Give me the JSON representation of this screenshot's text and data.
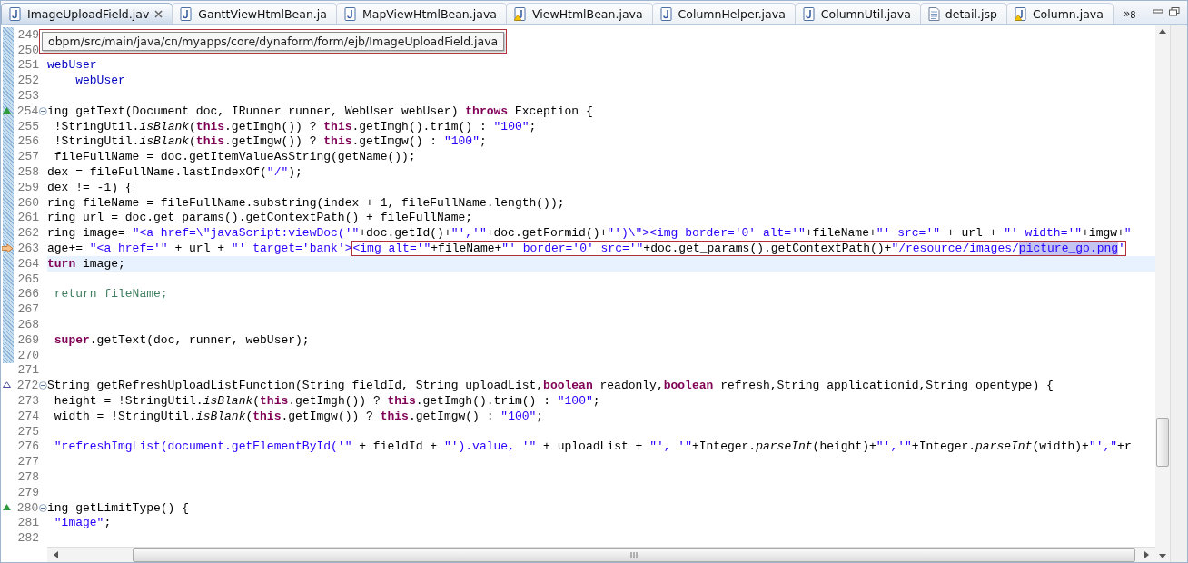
{
  "tabs": [
    {
      "label": "ImageUploadField.jav",
      "selected": true,
      "kind": "java"
    },
    {
      "label": "GanttViewHtmlBean.ja",
      "selected": false,
      "kind": "java"
    },
    {
      "label": "MapViewHtmlBean.java",
      "selected": false,
      "kind": "java"
    },
    {
      "label": "ViewHtmlBean.java",
      "selected": false,
      "kind": "warning"
    },
    {
      "label": "ColumnHelper.java",
      "selected": false,
      "kind": "java"
    },
    {
      "label": "ColumnUtil.java",
      "selected": false,
      "kind": "java"
    },
    {
      "label": "detail.jsp",
      "selected": false,
      "kind": "jsp"
    },
    {
      "label": "Column.java",
      "selected": false,
      "kind": "warning"
    }
  ],
  "overflow": {
    "glyph": "»",
    "count": "8"
  },
  "tooltip": "obpm/src/main/java/cn/myapps/core/dynaform/form/ejb/ImageUploadField.java",
  "lines": [
    {
      "no": "249",
      "changed": true,
      "current": false
    },
    {
      "no": "250",
      "changed": true,
      "current": false
    },
    {
      "no": "251",
      "changed": true,
      "current": false,
      "tokens": [
        {
          "kind": "field",
          "text": "webUser"
        }
      ]
    },
    {
      "no": "252",
      "changed": true,
      "current": false,
      "tokens": [
        {
          "kind": "field",
          "text": "    webUser"
        }
      ]
    },
    {
      "no": "253",
      "changed": true,
      "current": false
    },
    {
      "no": "254",
      "changed": true,
      "current": false,
      "kind": "override",
      "expanded": true,
      "tokens": [
        {
          "kind": "plain",
          "text": "ing getText(Document doc, IRunner runner, WebUser webUser) "
        },
        {
          "kind": "keyword",
          "text": "throws"
        },
        {
          "kind": "plain",
          "text": " Exception {"
        }
      ]
    },
    {
      "no": "255",
      "changed": true,
      "current": false,
      "tokens": [
        {
          "kind": "plain",
          "text": " !StringUtil."
        },
        {
          "kind": "italic",
          "text": "isBlank"
        },
        {
          "kind": "plain",
          "text": "("
        },
        {
          "kind": "keyword",
          "text": "this"
        },
        {
          "kind": "plain",
          "text": ".getImgh()) ? "
        },
        {
          "kind": "keyword",
          "text": "this"
        },
        {
          "kind": "plain",
          "text": ".getImgh().trim() : "
        },
        {
          "kind": "string",
          "text": "\"100\""
        },
        {
          "kind": "plain",
          "text": ";"
        }
      ]
    },
    {
      "no": "256",
      "changed": true,
      "current": false,
      "tokens": [
        {
          "kind": "plain",
          "text": " !StringUtil."
        },
        {
          "kind": "italic",
          "text": "isBlank"
        },
        {
          "kind": "plain",
          "text": "("
        },
        {
          "kind": "keyword",
          "text": "this"
        },
        {
          "kind": "plain",
          "text": ".getImgw()) ? "
        },
        {
          "kind": "keyword",
          "text": "this"
        },
        {
          "kind": "plain",
          "text": ".getImgw() : "
        },
        {
          "kind": "string",
          "text": "\"100\""
        },
        {
          "kind": "plain",
          "text": ";"
        }
      ]
    },
    {
      "no": "257",
      "changed": true,
      "current": false,
      "tokens": [
        {
          "kind": "plain",
          "text": " fileFullName = doc.getItemValueAsString(getName());"
        }
      ]
    },
    {
      "no": "258",
      "changed": true,
      "current": false,
      "tokens": [
        {
          "kind": "plain",
          "text": "dex = fileFullName.lastIndexOf("
        },
        {
          "kind": "string",
          "text": "\"/\""
        },
        {
          "kind": "plain",
          "text": ");"
        }
      ]
    },
    {
      "no": "259",
      "changed": true,
      "current": false,
      "tokens": [
        {
          "kind": "plain",
          "text": "dex != -1) {"
        }
      ]
    },
    {
      "no": "260",
      "changed": true,
      "current": false,
      "tokens": [
        {
          "kind": "plain",
          "text": "ring fileName = fileFullName.substring(index + 1, fileFullName.length());"
        }
      ]
    },
    {
      "no": "261",
      "changed": true,
      "current": false,
      "tokens": [
        {
          "kind": "plain",
          "text": "ring url = doc.get_params().getContextPath() + fileFullName;"
        }
      ]
    },
    {
      "no": "262",
      "changed": true,
      "current": false,
      "tokens": [
        {
          "kind": "plain",
          "text": "ring image= "
        },
        {
          "kind": "string",
          "text": "\"<a href=\\\"javaScript:viewDoc('\""
        },
        {
          "kind": "plain",
          "text": "+doc.getId()+"
        },
        {
          "kind": "string",
          "text": "\"','\""
        },
        {
          "kind": "plain",
          "text": "+doc.getFormid()+"
        },
        {
          "kind": "string",
          "text": "\"')\\\"><img border='0' alt='\""
        },
        {
          "kind": "plain",
          "text": "+fileName+"
        },
        {
          "kind": "string",
          "text": "\"' src='\""
        },
        {
          "kind": "plain",
          "text": " + url + "
        },
        {
          "kind": "string",
          "text": "\"' width='\""
        },
        {
          "kind": "plain",
          "text": "+imgw+"
        },
        {
          "kind": "string",
          "text": "\""
        }
      ]
    },
    {
      "no": "263",
      "changed": true,
      "current": false,
      "kind": "arrow",
      "tokens": [
        {
          "kind": "plain",
          "text": "age+= "
        },
        {
          "kind": "string",
          "text": "\"<a href='\""
        },
        {
          "kind": "plain",
          "text": " + url + "
        },
        {
          "kind": "string",
          "text": "\"' target='bank'>"
        },
        {
          "kind": "frame",
          "tokens": [
            {
              "kind": "string",
              "text": "<img alt='\""
            },
            {
              "kind": "plain",
              "text": "+fileName+"
            },
            {
              "kind": "string",
              "text": "\"' border='0' src='\""
            },
            {
              "kind": "plain",
              "text": "+doc.get_params().getContextPath()+"
            },
            {
              "kind": "string",
              "text": "\"/resource/images/"
            },
            {
              "kind": "string",
              "selected": true,
              "text": "picture_go.png"
            },
            {
              "kind": "string",
              "text": "'"
            }
          ]
        }
      ]
    },
    {
      "no": "264",
      "changed": true,
      "current": true,
      "tokens": [
        {
          "kind": "keyword",
          "text": "turn"
        },
        {
          "kind": "plain",
          "text": " image;"
        }
      ]
    },
    {
      "no": "265",
      "changed": true,
      "current": false
    },
    {
      "no": "266",
      "changed": true,
      "current": false,
      "tokens": [
        {
          "kind": "dim",
          "text": " return fileName;"
        }
      ]
    },
    {
      "no": "267",
      "changed": true,
      "current": false
    },
    {
      "no": "268",
      "changed": true,
      "current": false
    },
    {
      "no": "269",
      "changed": true,
      "current": false,
      "tokens": [
        {
          "kind": "keyword",
          "text": " super"
        },
        {
          "kind": "plain",
          "text": ".getText(doc, runner, webUser);"
        }
      ]
    },
    {
      "no": "270",
      "changed": true,
      "current": false
    },
    {
      "no": "271",
      "changed": false,
      "current": false
    },
    {
      "no": "272",
      "changed": false,
      "current": false,
      "kind": "implement",
      "expanded": true,
      "tokens": [
        {
          "kind": "plain",
          "text": "String getRefreshUploadListFunction(String fieldId, String uploadList,"
        },
        {
          "kind": "keyword",
          "text": "boolean"
        },
        {
          "kind": "plain",
          "text": " readonly,"
        },
        {
          "kind": "keyword",
          "text": "boolean"
        },
        {
          "kind": "plain",
          "text": " refresh,String applicationid,String opentype) {"
        }
      ]
    },
    {
      "no": "273",
      "changed": false,
      "current": false,
      "tokens": [
        {
          "kind": "plain",
          "text": " height = !StringUtil."
        },
        {
          "kind": "italic",
          "text": "isBlank"
        },
        {
          "kind": "plain",
          "text": "("
        },
        {
          "kind": "keyword",
          "text": "this"
        },
        {
          "kind": "plain",
          "text": ".getImgh()) ? "
        },
        {
          "kind": "keyword",
          "text": "this"
        },
        {
          "kind": "plain",
          "text": ".getImgh().trim() : "
        },
        {
          "kind": "string",
          "text": "\"100\""
        },
        {
          "kind": "plain",
          "text": ";"
        }
      ]
    },
    {
      "no": "274",
      "changed": false,
      "current": false,
      "tokens": [
        {
          "kind": "plain",
          "text": " width = !StringUtil."
        },
        {
          "kind": "italic",
          "text": "isBlank"
        },
        {
          "kind": "plain",
          "text": "("
        },
        {
          "kind": "keyword",
          "text": "this"
        },
        {
          "kind": "plain",
          "text": ".getImgw()) ? "
        },
        {
          "kind": "keyword",
          "text": "this"
        },
        {
          "kind": "plain",
          "text": ".getImgw() : "
        },
        {
          "kind": "string",
          "text": "\"100\""
        },
        {
          "kind": "plain",
          "text": ";"
        }
      ]
    },
    {
      "no": "275",
      "changed": false,
      "current": false
    },
    {
      "no": "276",
      "changed": false,
      "current": false,
      "tokens": [
        {
          "kind": "string",
          "text": " \"refreshImgList(document.getElementById('\""
        },
        {
          "kind": "plain",
          "text": " + fieldId + "
        },
        {
          "kind": "string",
          "text": "\"').value, '\""
        },
        {
          "kind": "plain",
          "text": " + uploadList + "
        },
        {
          "kind": "string",
          "text": "\"', '\""
        },
        {
          "kind": "plain",
          "text": "+Integer."
        },
        {
          "kind": "italic",
          "text": "parseInt"
        },
        {
          "kind": "plain",
          "text": "(height)+"
        },
        {
          "kind": "string",
          "text": "\"','\""
        },
        {
          "kind": "plain",
          "text": "+Integer."
        },
        {
          "kind": "italic",
          "text": "parseInt"
        },
        {
          "kind": "plain",
          "text": "(width)+"
        },
        {
          "kind": "string",
          "text": "\"',\""
        },
        {
          "kind": "plain",
          "text": "+r"
        }
      ]
    },
    {
      "no": "277",
      "changed": false,
      "current": false
    },
    {
      "no": "278",
      "changed": false,
      "current": false
    },
    {
      "no": "279",
      "changed": false,
      "current": false
    },
    {
      "no": "280",
      "changed": false,
      "current": false,
      "kind": "override",
      "expanded": true,
      "tokens": [
        {
          "kind": "plain",
          "text": "ing getLimitType() {"
        }
      ]
    },
    {
      "no": "281",
      "changed": false,
      "current": false,
      "tokens": [
        {
          "kind": "string",
          "text": " \"image\""
        },
        {
          "kind": "plain",
          "text": ";"
        }
      ]
    },
    {
      "no": "282",
      "changed": false,
      "current": false
    }
  ]
}
